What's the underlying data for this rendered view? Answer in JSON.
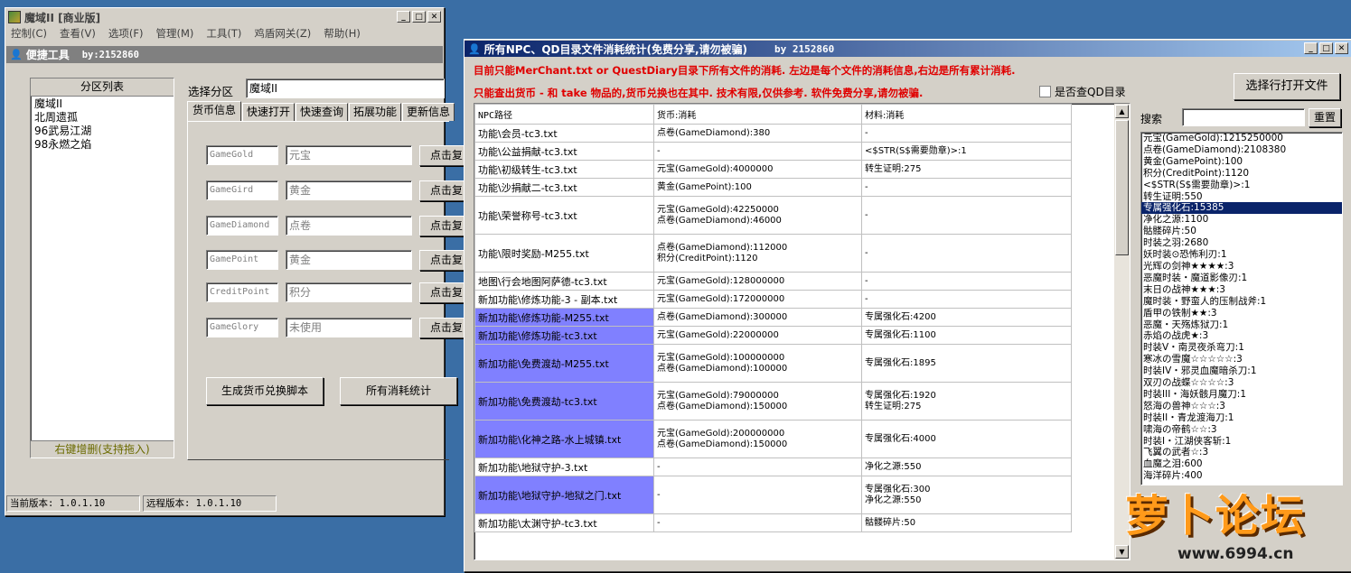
{
  "win1": {
    "title": "魔域II  [商业版]",
    "menu": [
      "控制(C)",
      "查看(V)",
      "选项(F)",
      "管理(M)",
      "工具(T)",
      "鸡盾网关(Z)",
      "帮助(H)"
    ],
    "tool_title": "便捷工具",
    "tool_by": "by:2152860",
    "zone_list_header": "分区列表",
    "zones": [
      "魔域II",
      "北周遗孤",
      "96武易江湖",
      "98永燃之焰"
    ],
    "zone_hint": "右键增删(支持拖入)",
    "select_zone_label": "选择分区",
    "select_zone_value": "魔域II",
    "tabs": [
      "货币信息",
      "快速打开",
      "快速查询",
      "拓展功能",
      "更新信息"
    ],
    "currency_rows": [
      {
        "code": "GameGold",
        "name": "元宝",
        "btn": "点击复"
      },
      {
        "code": "GameGird",
        "name": "黄金",
        "btn": "点击复"
      },
      {
        "code": "GameDiamond",
        "name": "点卷",
        "btn": "点击复"
      },
      {
        "code": "GamePoint",
        "name": "黄金",
        "btn": "点击复"
      },
      {
        "code": "CreditPoint",
        "name": "积分",
        "btn": "点击复"
      },
      {
        "code": "GameGlory",
        "name": "未使用",
        "btn": "点击复"
      }
    ],
    "gen_button": "生成货币兑换脚本",
    "all_stats_button": "所有消耗统计",
    "status_local": "当前版本: 1.0.1.10",
    "status_remote": "远程版本: 1.0.1.10"
  },
  "win2": {
    "title": "所有NPC、QD目录文件消耗统计(免费分享,请勿被骗)",
    "title_by": "by 2152860",
    "notice1": "目前只能MerChant.txt or QuestDiary目录下所有文件的消耗. 左边是每个文件的消耗信息,右边是所有累计消耗.",
    "notice2": "只能查出货币 - 和 take 物品的,货币兑换也在其中. 技术有限,仅供参考. 软件免费分享,请勿被骗.",
    "check_qd": "是否查QD目录",
    "open_btn": "选择行打开文件",
    "search_label": "搜索",
    "reset_btn": "重置",
    "table_headers": [
      "NPC路径",
      "货币:消耗",
      "材料:消耗"
    ],
    "rows": [
      {
        "path": "功能\\会员-tc3.txt",
        "money": [
          "点卷(GameDiamond):380"
        ],
        "mat": [
          "-"
        ],
        "hl": false
      },
      {
        "path": "功能\\公益捐献-tc3.txt",
        "money": [
          "-"
        ],
        "mat": [
          "<$STR(S$需要勋章)>:1"
        ],
        "hl": false
      },
      {
        "path": "功能\\初级转生-tc3.txt",
        "money": [
          "元宝(GameGold):4000000"
        ],
        "mat": [
          "转生证明:275"
        ],
        "hl": false
      },
      {
        "path": "功能\\沙捐献二-tc3.txt",
        "money": [
          "黄金(GamePoint):100"
        ],
        "mat": [
          "-"
        ],
        "hl": false
      },
      {
        "path": "功能\\荣誉称号-tc3.txt",
        "money": [
          "元宝(GameGold):42250000",
          "点卷(GameDiamond):46000"
        ],
        "mat": [
          "-"
        ],
        "hl": false
      },
      {
        "path": "功能\\限时奖励-M255.txt",
        "money": [
          "点卷(GameDiamond):112000",
          "积分(CreditPoint):1120"
        ],
        "mat": [
          "-"
        ],
        "hl": false
      },
      {
        "path": "地图\\行会地图阿萨德-tc3.txt",
        "money": [
          "元宝(GameGold):128000000"
        ],
        "mat": [
          "-"
        ],
        "hl": false
      },
      {
        "path": "新加功能\\修炼功能-3 - 副本.txt",
        "money": [
          "元宝(GameGold):172000000"
        ],
        "mat": [
          "-"
        ],
        "hl": false
      },
      {
        "path": "新加功能\\修炼功能-M255.txt",
        "money": [
          "点卷(GameDiamond):300000"
        ],
        "mat": [
          "专属强化石:4200"
        ],
        "hl": true
      },
      {
        "path": "新加功能\\修炼功能-tc3.txt",
        "money": [
          "元宝(GameGold):22000000"
        ],
        "mat": [
          "专属强化石:1100"
        ],
        "hl": true
      },
      {
        "path": "新加功能\\免费渡劫-M255.txt",
        "money": [
          "元宝(GameGold):100000000",
          "点卷(GameDiamond):100000"
        ],
        "mat": [
          "专属强化石:1895"
        ],
        "hl": true
      },
      {
        "path": "新加功能\\免费渡劫-tc3.txt",
        "money": [
          "元宝(GameGold):79000000",
          "点卷(GameDiamond):150000"
        ],
        "mat": [
          "专属强化石:1920",
          "转生证明:275"
        ],
        "hl": true
      },
      {
        "path": "新加功能\\化神之路-水上城镇.txt",
        "money": [
          "元宝(GameGold):200000000",
          "点卷(GameDiamond):150000"
        ],
        "mat": [
          "专属强化石:4000"
        ],
        "hl": true
      },
      {
        "path": "新加功能\\地狱守护-3.txt",
        "money": [
          "-"
        ],
        "mat": [
          "净化之源:550"
        ],
        "hl": false
      },
      {
        "path": "新加功能\\地狱守护-地狱之门.txt",
        "money": [
          "-"
        ],
        "mat": [
          "专属强化石:300",
          "净化之源:550"
        ],
        "hl": true
      },
      {
        "path": "新加功能\\太渊守护-tc3.txt",
        "money": [
          "-"
        ],
        "mat": [
          "骷髅碎片:50"
        ],
        "hl": false
      }
    ],
    "totals": [
      "元宝(GameGold):1215250000",
      "点卷(GameDiamond):2108380",
      "黄金(GamePoint):100",
      "积分(CreditPoint):1120",
      "<$STR(S$需要勋章)>:1",
      "转生证明:550",
      "专属强化石:15385",
      "净化之源:1100",
      "骷髅碎片:50",
      "时装之羽:2680",
      "妖时装⊙恐怖利刃:1",
      "光辉の剑神★★★★:3",
      "恶魔时装・魔道影像刃:1",
      "末日の战神★★★:3",
      "魔时装・野蛮人的压制战斧:1",
      "盾甲の铁制★★:3",
      "恶魔・天殇炼狱刀:1",
      "赤焰の战虎★:3",
      "时装V・南灵夜杀弯刀:1",
      "寒冰の雪魔☆☆☆☆☆:3",
      "时装IV・邪灵血魔暗杀刀:1",
      "双刃の战蝶☆☆☆☆:3",
      "时装III・海妖骸月魔刀:1",
      "怒海の兽神☆☆☆:3",
      "时装II・青龙渡海刀:1",
      "啸海の帝鹤☆☆:3",
      "时装I・江湖侠客斩:1",
      "飞翼の武者☆:3",
      "血魔之泪:600",
      "海洋碎片:400"
    ],
    "selected_total_index": 6
  },
  "watermark": {
    "logo_text": "萝卜论坛",
    "url": "www.6994.cn"
  }
}
